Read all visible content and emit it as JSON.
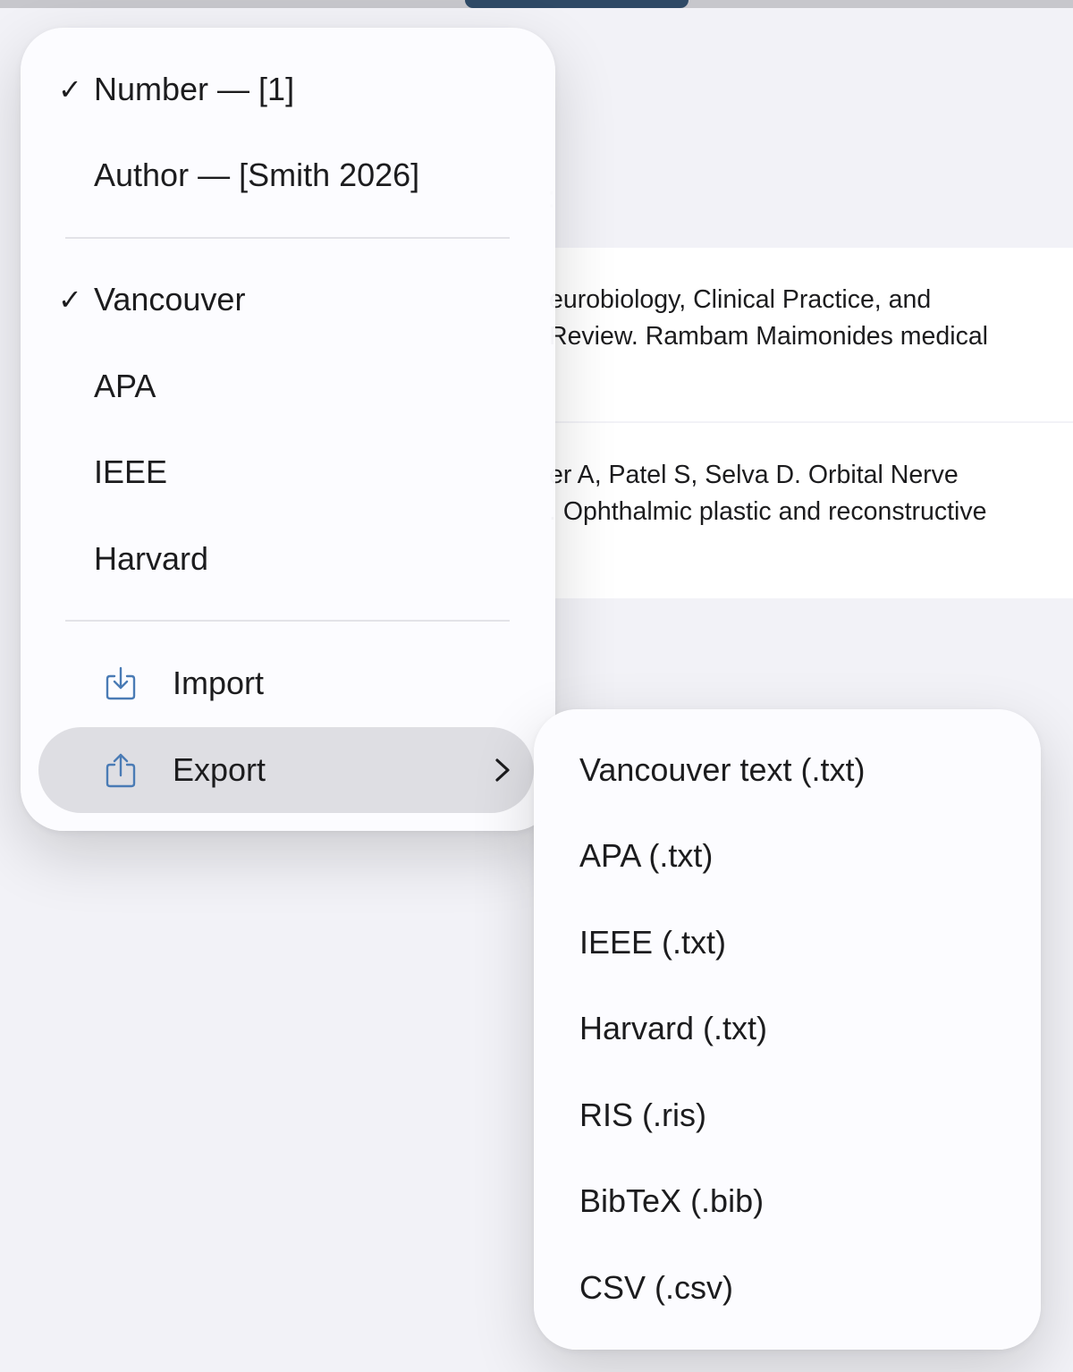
{
  "background": {
    "fragment": ":",
    "references": [
      {
        "lines": [
          "eurobiology, Clinical Practice, and",
          "Review. Rambam Maimonides medical"
        ]
      },
      {
        "lines": [
          "er A, Patel S, Selva D. Orbital Nerve",
          ". Ophthalmic plastic and reconstructive"
        ]
      }
    ]
  },
  "menu": {
    "citation_styles": [
      {
        "label": "Number — [1]",
        "checked": true,
        "check": "✓"
      },
      {
        "label": "Author — [Smith 2026]",
        "checked": false,
        "check": ""
      }
    ],
    "reference_formats": [
      {
        "label": "Vancouver",
        "checked": true,
        "check": "✓"
      },
      {
        "label": "APA",
        "checked": false,
        "check": ""
      },
      {
        "label": "IEEE",
        "checked": false,
        "check": ""
      },
      {
        "label": "Harvard",
        "checked": false,
        "check": ""
      }
    ],
    "actions": [
      {
        "label": "Import",
        "icon": "import-icon",
        "highlighted": false
      },
      {
        "label": "Export",
        "icon": "export-icon",
        "highlighted": true,
        "has_submenu": true
      }
    ]
  },
  "export_submenu": {
    "items": [
      {
        "label": "Vancouver text (.txt)"
      },
      {
        "label": "APA (.txt)"
      },
      {
        "label": "IEEE (.txt)"
      },
      {
        "label": "Harvard (.txt)"
      },
      {
        "label": "RIS (.ris)"
      },
      {
        "label": "BibTeX (.bib)"
      },
      {
        "label": "CSV (.csv)"
      }
    ]
  },
  "colors": {
    "icon_accent": "#4a7bb5",
    "highlight": "#dedee3",
    "header_accent": "#2f4a66"
  }
}
